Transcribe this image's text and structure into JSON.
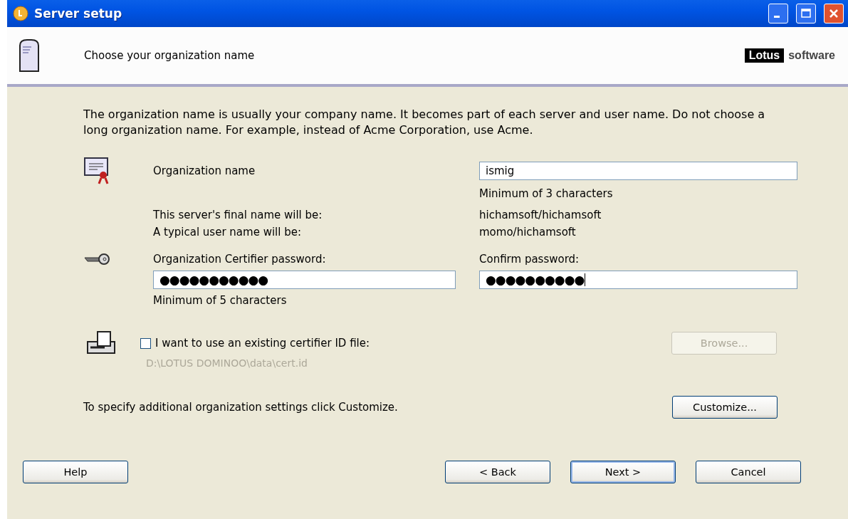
{
  "window": {
    "title": "Server setup"
  },
  "header": {
    "title": "Choose your organization name",
    "brand_dark": "Lotus",
    "brand_light": "software"
  },
  "intro": "The organization name is usually your company name. It becomes part of each server and user name. Do not choose a long organization name. For example, instead of Acme Corporation, use Acme.",
  "org_name": {
    "label": "Organization name",
    "value": "ismig",
    "hint": "Minimum of 3 characters"
  },
  "server_name": {
    "label": "This server's final name will be:",
    "value": "hichamsoft/hichamsoft"
  },
  "user_name": {
    "label": "A typical user name will be:",
    "value": "momo/hichamsoft"
  },
  "password": {
    "label": "Organization Certifier password:",
    "value": "●●●●●●●●●●●",
    "hint": "Minimum of 5 characters"
  },
  "confirm": {
    "label": "Confirm password:",
    "value": "●●●●●●●●●●",
    "focused": true
  },
  "existing_id": {
    "label": "I want to use an existing certifier ID file:",
    "checked": false,
    "path": "D:\\LOTUS DOMINOO\\data\\cert.id",
    "browse": {
      "label": "Browse...",
      "disabled": true
    }
  },
  "customize": {
    "text": "To specify additional organization settings click Customize.",
    "button": {
      "label": "Customize...",
      "disabled": false
    }
  },
  "buttons": [
    {
      "label": "Help",
      "default": false
    },
    {
      "label": "< Back",
      "default": false
    },
    {
      "label": "Next >",
      "default": true
    },
    {
      "label": "Cancel",
      "default": false
    }
  ]
}
